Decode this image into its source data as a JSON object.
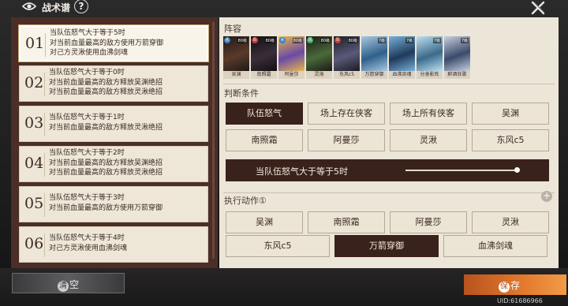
{
  "header": {
    "title": "战术谱",
    "help_label": "?"
  },
  "strategies": [
    {
      "num": "01",
      "lines": [
        "当队伍怒气大于等于5时",
        "对当前血量最高的敌方使用万箭穿御",
        "对己方灵湫使用血沸剑魂"
      ],
      "active": true
    },
    {
      "num": "02",
      "lines": [
        "当队伍怒气大于等于0时",
        "对当前血量最高的敌方释放吴渊绝招",
        "对当前血量最高的敌方释放灵湫绝招"
      ]
    },
    {
      "num": "03",
      "lines": [
        "当队伍怒气大于等于1时",
        "对当前血量最高的敌方释放灵湫绝招"
      ]
    },
    {
      "num": "04",
      "lines": [
        "当队伍怒气大于等于2时",
        "对当前血量最高的敌方释放吴渊绝招",
        "对当前血量最高的敌方释放灵湫绝招"
      ]
    },
    {
      "num": "05",
      "lines": [
        "当队伍怒气大于等于3时",
        "对当前血量最高的敌方使用万箭穿御"
      ]
    },
    {
      "num": "06",
      "lines": [
        "当队伍怒气大于等于4时",
        "对己方灵湫使用血沸剑魂"
      ]
    }
  ],
  "lineup": {
    "label": "阵容",
    "heroes": [
      {
        "name": "吴渊",
        "tag": "80级",
        "elem": "水",
        "elem_color": "#3d7fc2",
        "art": [
          "#5a3a2a",
          "#1f1a18"
        ]
      },
      {
        "name": "南照霜",
        "tag": "80级",
        "elem": "炎",
        "elem_color": "#c23d3d",
        "art": [
          "#3a2d3a",
          "#121012"
        ]
      },
      {
        "name": "阿曼莎",
        "tag": "80级",
        "elem": "水",
        "elem_color": "#3d7fc2",
        "art": [
          "#6a4aa8",
          "#e6b84a"
        ]
      },
      {
        "name": "灵湫",
        "tag": "80级",
        "elem": "风",
        "elem_color": "#3da86a",
        "art": [
          "#4a6a3a",
          "#1c1a16"
        ]
      },
      {
        "name": "东风c5",
        "tag": "80级",
        "elem": "炎",
        "elem_color": "#c23d3d",
        "art": [
          "#5a5a7a",
          "#1c1c24"
        ]
      },
      {
        "name": "万箭穿御",
        "tag": "7级",
        "art": [
          "#2f5f8a",
          "#a8c8e0"
        ]
      },
      {
        "name": "血沸剑魂",
        "tag": "7级",
        "art": [
          "#1e3a5a",
          "#7ab0d8"
        ]
      },
      {
        "name": "分身影阵",
        "tag": "7级",
        "art": [
          "#3a6a8a",
          "#bfe0f0"
        ]
      },
      {
        "name": "醉酒狂歌",
        "tag": "7级",
        "art": [
          "#3a4a6a",
          "#c8d0e0"
        ]
      }
    ]
  },
  "conditions": {
    "label": "判断条件",
    "options": [
      "队伍怒气",
      "场上存在侠客",
      "场上所有侠客",
      "吴渊",
      "南照霜",
      "阿曼莎",
      "灵湫",
      "东风c5"
    ],
    "selected_index": 0,
    "active_text": "当队伍怒气大于等于5时",
    "slider_level": 5
  },
  "actions": {
    "label": "执行动作",
    "info_icon": "①",
    "options": [
      "吴渊",
      "南照霜",
      "阿曼莎",
      "灵湫",
      "东风c5",
      "万箭穿御",
      "血沸剑魂"
    ],
    "selected_index": 5
  },
  "footer": {
    "clear_seal": "清",
    "clear_rest": "空",
    "save_seal": "保",
    "save_rest": "存",
    "uid": "UID:61686966"
  }
}
